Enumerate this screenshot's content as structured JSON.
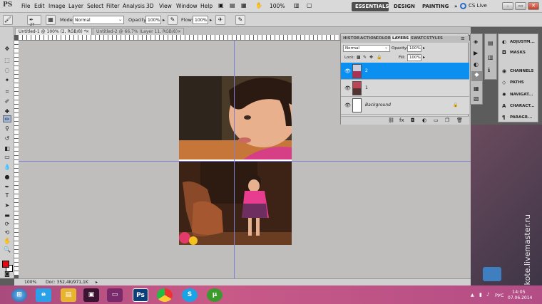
{
  "app": {
    "logo": "PS"
  },
  "menu": [
    "File",
    "Edit",
    "Image",
    "Layer",
    "Select",
    "Filter",
    "Analysis",
    "3D",
    "View",
    "Window",
    "Help"
  ],
  "zoom": "100%",
  "workspaces": {
    "essentials": "ESSENTIALS",
    "design": "DESIGN",
    "painting": "PAINTING",
    "more": "»"
  },
  "cslive": "CS Live",
  "options": {
    "brush_size": "27",
    "mode_label": "Mode:",
    "mode_value": "Normal",
    "opacity_label": "Opacity:",
    "opacity_value": "100%",
    "flow_label": "Flow:",
    "flow_value": "100%"
  },
  "tabs": [
    {
      "label": "Untitled-1 @ 100% (2, RGB/8) *"
    },
    {
      "label": "Untitled-2 @ 66,7% (Layer 11, RGB/8) *"
    }
  ],
  "status": {
    "zoom": "100%",
    "doc": "Doc: 352,4K/971,1K"
  },
  "layers_panel": {
    "tabs": [
      "HISTOR",
      "ACTION",
      "COLOR",
      "LAYERS",
      "SWATC",
      "STYLES"
    ],
    "blend_mode": "Normal",
    "opacity_label": "Opacity:",
    "opacity_value": "100%",
    "lock_label": "Lock:",
    "fill_label": "Fill:",
    "fill_value": "100%",
    "layers": [
      {
        "name": "2",
        "selected": true
      },
      {
        "name": "1",
        "selected": false
      },
      {
        "name": "Background",
        "selected": false
      }
    ]
  },
  "right_panel": {
    "items": [
      {
        "icon": "adjustments-icon",
        "label": "ADJUSTM..."
      },
      {
        "icon": "masks-icon",
        "label": "MASKS"
      },
      {
        "icon": "channels-icon",
        "label": "CHANNELS"
      },
      {
        "icon": "paths-icon",
        "label": "PATHS"
      },
      {
        "icon": "navigator-icon",
        "label": "NAVIGAT..."
      },
      {
        "icon": "character-icon",
        "label": "CHARACT..."
      },
      {
        "icon": "paragraph-icon",
        "label": "PARAGR..."
      }
    ]
  },
  "watermark": "art-kote.livemaster.ru",
  "tray": {
    "lang": "РУС",
    "time": "14:05",
    "date": "07.06.2014"
  },
  "colors": {
    "accent_selected": "#0b8ff0",
    "foreground": "#e30613",
    "background": "#ffffff",
    "taskbar": "#b34d86"
  }
}
